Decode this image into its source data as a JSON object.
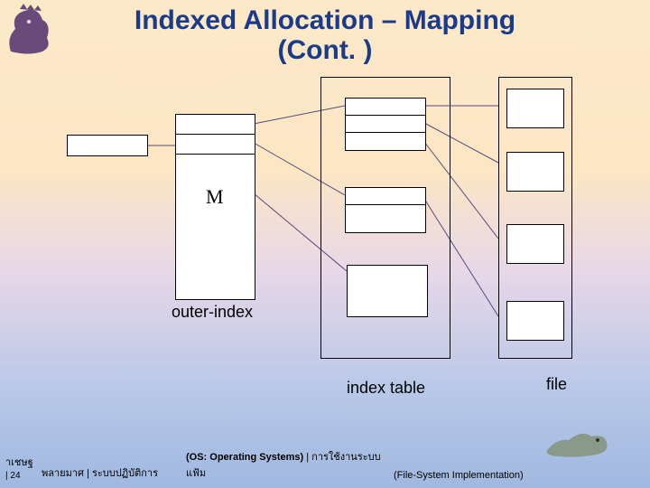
{
  "title_line1": "Indexed Allocation – Mapping",
  "title_line2": "(Cont. )",
  "labels": {
    "outer_index": "outer-index",
    "index_table": "index table",
    "file": "file"
  },
  "symbols": {
    "m": "M"
  },
  "footer": {
    "author_left": "าเชษฐ",
    "dept": "พลายมาศ | ระบบปฏิบัติการ",
    "course_bold": "(OS: Operating Systems)",
    "course_rest": " | การใช้งานระบบแฟ้ม",
    "topic": "(File-System Implementation)",
    "page": "| 24"
  }
}
